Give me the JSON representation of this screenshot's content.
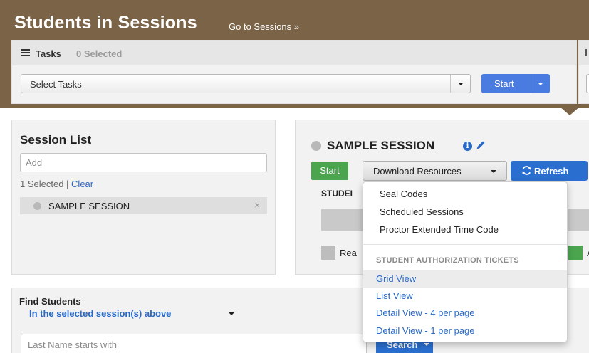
{
  "header": {
    "title": "Students in Sessions",
    "goto_link": "Go to Sessions »"
  },
  "tasks": {
    "label": "Tasks",
    "selected_count": "0 Selected",
    "select_placeholder": "Select Tasks",
    "start_label": "Start"
  },
  "session_list": {
    "title": "Session List",
    "add_placeholder": "Add",
    "selected_text": "1 Selected |",
    "clear_label": "Clear",
    "items": [
      {
        "label": "SAMPLE SESSION",
        "remove": "×"
      }
    ]
  },
  "session": {
    "name": "SAMPLE SESSION",
    "info_glyph": "i",
    "start_label": "Start",
    "download_label": "Download Resources",
    "refresh_label": "Refresh",
    "students_label": "STUDEI",
    "legend_left": "Rea",
    "legend_right": "A"
  },
  "download_menu": {
    "items": [
      "Seal Codes",
      "Scheduled Sessions",
      "Proctor Extended Time Code"
    ],
    "section_header": "STUDENT AUTHORIZATION TICKETS",
    "ticket_items": [
      "Grid View",
      "List View",
      "Detail View - 4 per page",
      "Detail View - 1 per page"
    ],
    "active_item": "Grid View"
  },
  "find_students": {
    "title": "Find Students",
    "scope": "In the selected session(s) above",
    "input_placeholder": "Last Name starts with",
    "search_label": "Search"
  },
  "colors": {
    "header_band": "#7a6346",
    "primary_blue": "#2a6fd0",
    "start_blue": "#4a7be0",
    "success_green": "#4aa54e",
    "link_blue": "#2b69c4"
  }
}
